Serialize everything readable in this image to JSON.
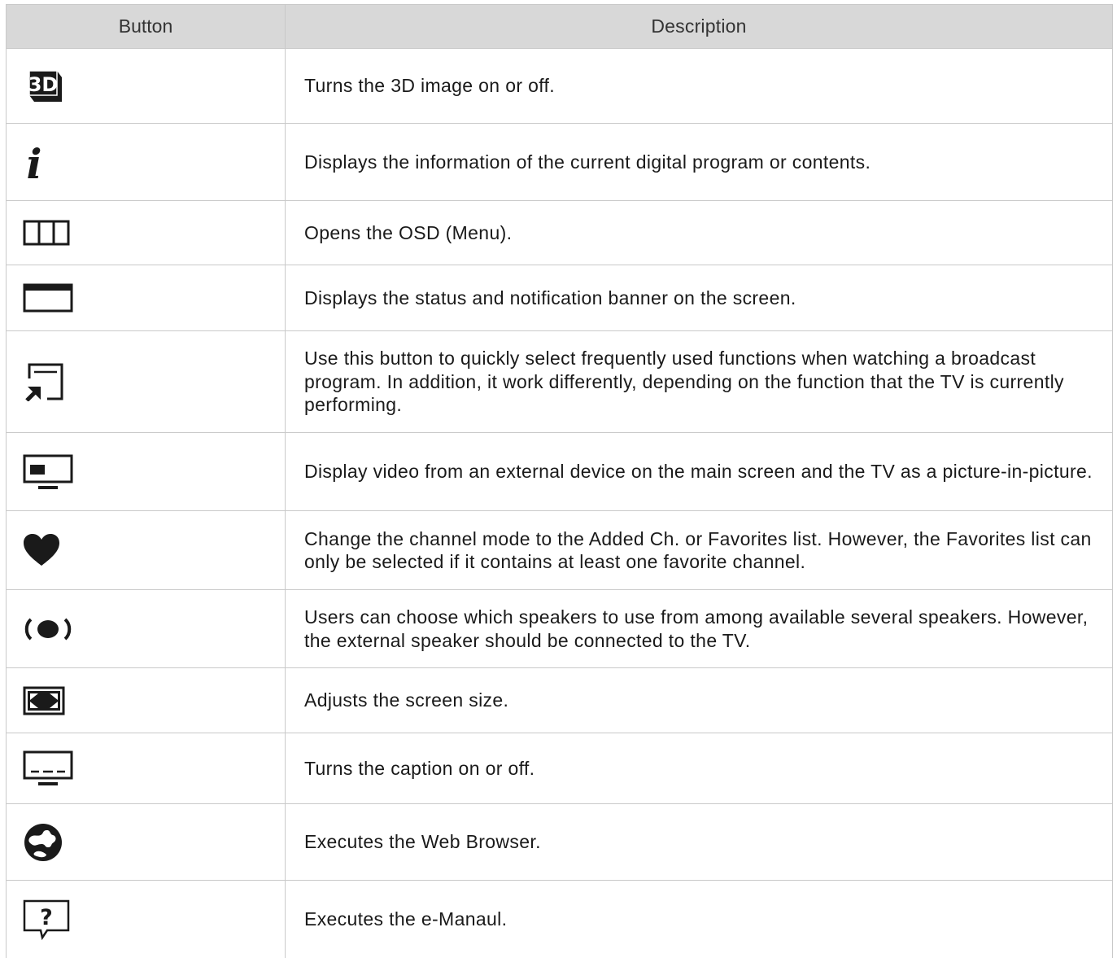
{
  "header": {
    "button": "Button",
    "description": "Description"
  },
  "rows": [
    {
      "icon": "3d-icon",
      "description": "Turns the 3D image on or off."
    },
    {
      "icon": "info-icon",
      "description": "Displays the information of the current digital program or contents."
    },
    {
      "icon": "menu-icon",
      "description": "Opens the OSD (Menu)."
    },
    {
      "icon": "status-banner-icon",
      "description": "Displays the status and notification banner on the screen."
    },
    {
      "icon": "tools-shortcut-icon",
      "description": "Use this button to quickly select frequently used functions when watching a broadcast program. In addition, it work differently, depending on the function that the TV is currently performing."
    },
    {
      "icon": "pip-icon",
      "description": "Display video from an external device on the main screen and the TV as a picture-in-picture."
    },
    {
      "icon": "heart-icon",
      "description": "Change the channel mode to the Added Ch. or Favorites list. However, the Favorites list can only be selected if it contains at least one favorite channel."
    },
    {
      "icon": "speaker-icon",
      "description": "Users can choose which speakers to use from among available several speakers. However, the external speaker should be connected to the TV."
    },
    {
      "icon": "picture-size-icon",
      "description": "Adjusts the screen size."
    },
    {
      "icon": "caption-icon",
      "description": "Turns the caption on or off."
    },
    {
      "icon": "web-browser-icon",
      "description": "Executes the Web Browser."
    },
    {
      "icon": "e-manual-icon",
      "description": "Executes the e-Manaul."
    }
  ]
}
